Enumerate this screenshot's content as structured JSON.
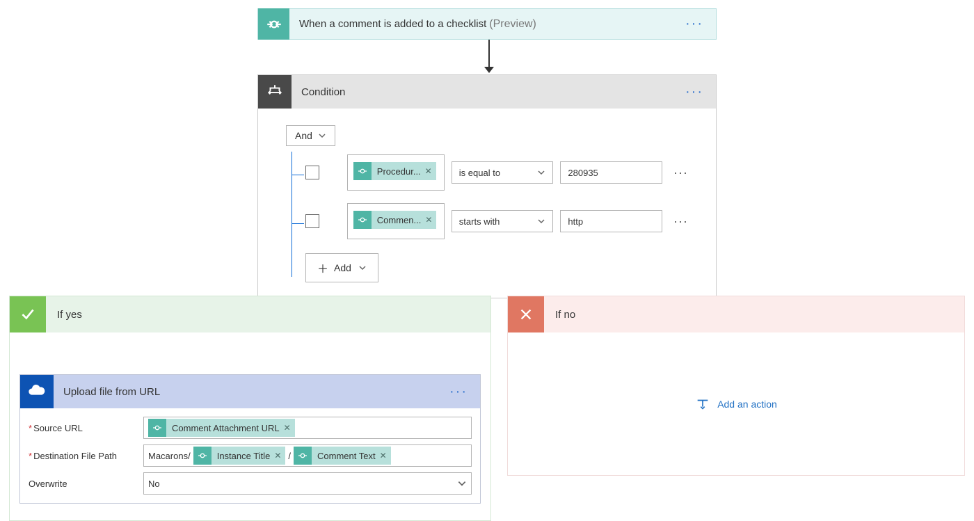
{
  "trigger": {
    "title": "When a comment is added to a checklist",
    "tag": "(Preview)"
  },
  "condition": {
    "title": "Condition",
    "group_operator": "And",
    "add_label": "Add",
    "rows": [
      {
        "token": "Procedur...",
        "operator": "is equal to",
        "value": "280935"
      },
      {
        "token": "Commen...",
        "operator": "starts with",
        "value": "http"
      }
    ]
  },
  "if_yes": {
    "title": "If yes",
    "upload": {
      "title": "Upload file from URL",
      "fields": {
        "source_url": {
          "label": "Source URL",
          "token": "Comment Attachment URL"
        },
        "dest_path": {
          "label": "Destination File Path",
          "text_prefix": "Macarons/",
          "token1": "Instance Title",
          "sep": "/",
          "token2": "Comment Text"
        },
        "overwrite": {
          "label": "Overwrite",
          "value": "No"
        }
      }
    }
  },
  "if_no": {
    "title": "If no",
    "add_action": "Add an action"
  }
}
